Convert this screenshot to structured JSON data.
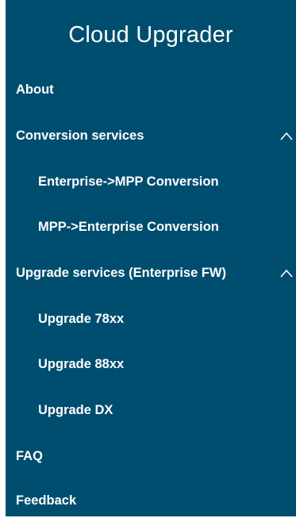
{
  "app": {
    "title": "Cloud Upgrader"
  },
  "sidebar": {
    "items": [
      {
        "label": "About"
      },
      {
        "label": "Conversion services",
        "expanded": true,
        "icon": "chevron-up-icon"
      },
      {
        "label": "Enterprise->MPP Conversion"
      },
      {
        "label": "MPP->Enterprise Conversion"
      },
      {
        "label": "Upgrade services (Enterprise FW)",
        "expanded": true,
        "icon": "chevron-up-icon"
      },
      {
        "label": "Upgrade 78xx"
      },
      {
        "label": "Upgrade 88xx"
      },
      {
        "label": "Upgrade DX"
      },
      {
        "label": "FAQ"
      },
      {
        "label": "Feedback"
      }
    ]
  },
  "colors": {
    "sidebar_bg": "#004e6f",
    "text": "#ffffff"
  }
}
